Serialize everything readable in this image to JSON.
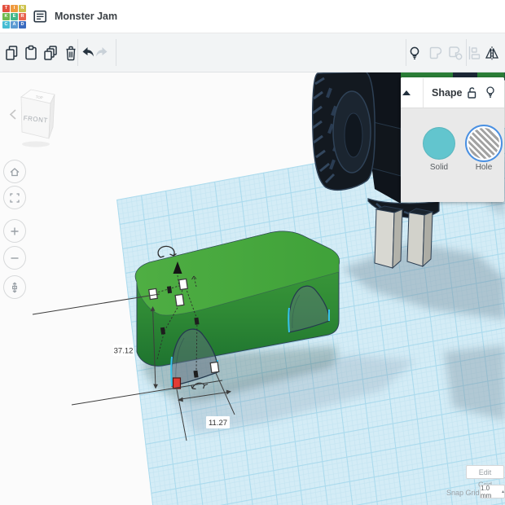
{
  "header": {
    "title": "Monster Jam",
    "logo_letters": [
      "T",
      "I",
      "N",
      "K",
      "E",
      "R",
      "C",
      "A",
      "D"
    ]
  },
  "toolbar": {
    "icons_left": [
      "copy",
      "paste",
      "duplicate",
      "delete",
      "undo",
      "redo"
    ],
    "icons_right": [
      "show-all-lightbulb",
      "group",
      "ungroup",
      "align",
      "mirror"
    ]
  },
  "sidebar": {
    "buttons": [
      "home-view",
      "fit-view",
      "zoom-in",
      "zoom-out",
      "perspective-toggle"
    ]
  },
  "viewcube": {
    "front_label": "FRONT",
    "top_label": "TOP"
  },
  "shape_panel": {
    "title": "Shape",
    "solid_label": "Solid",
    "hole_label": "Hole",
    "selected_option": "Hole",
    "solid_color": "#62c5ce",
    "selection_ring_color": "#4a90e2"
  },
  "scene": {
    "dimension_depth": "37.12",
    "dimension_width": "11.27",
    "objects": [
      "car-body-box",
      "wheel-arch-hole-front",
      "wheel-arch-hole-rear",
      "monster-truck-wheels",
      "monster-truck-stands"
    ],
    "box_color": "#3f9c3b",
    "workplane_color": "#d4ecf6"
  },
  "grid_controls": {
    "edit_grid_label": "Edit Grid",
    "snap_grid_label": "Snap Grid",
    "snap_grid_value": "1.0 mm",
    "caret": "▴"
  }
}
